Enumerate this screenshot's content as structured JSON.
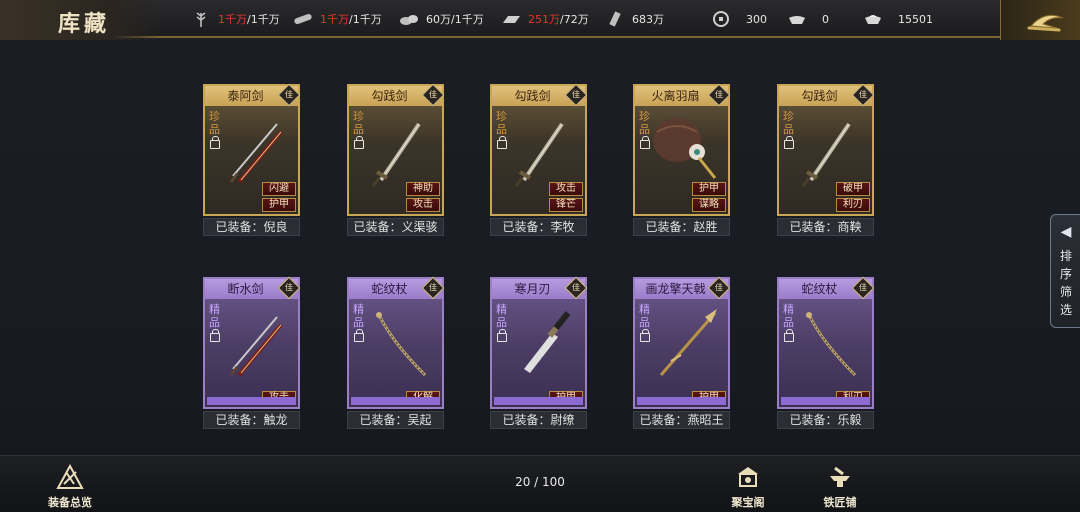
{
  "header": {
    "title": "库藏",
    "resources": [
      {
        "icon": "wheat-icon",
        "value": "1千万",
        "max": "/1千万",
        "value_red": true
      },
      {
        "icon": "wood-icon",
        "value": "1千万",
        "max": "/1千万",
        "value_red": true
      },
      {
        "icon": "stone-icon",
        "value": "60万",
        "max": "/1千万",
        "value_red": false
      },
      {
        "icon": "iron-icon",
        "value": "251万",
        "max": "/72万",
        "value_red": true
      },
      {
        "icon": "decree-icon",
        "value": "683万",
        "max": "",
        "value_red": false
      },
      {
        "icon": "copper-coin-icon",
        "value": "300",
        "max": "",
        "value_red": false
      },
      {
        "icon": "gold-ingot-icon",
        "value": "0",
        "max": "",
        "value_red": false
      },
      {
        "icon": "silver-ingot-icon",
        "value": "15501",
        "max": "",
        "value_red": false
      }
    ]
  },
  "badge_label": "佳",
  "equipped_prefix": "已装备：",
  "cards": [
    {
      "name": "泰阿剑",
      "grade": "珍品",
      "rarity": "gold",
      "weapon": "sword-pair",
      "attrs": [
        "闪避",
        "护甲"
      ],
      "owner": "倪良"
    },
    {
      "name": "勾践剑",
      "grade": "珍品",
      "rarity": "gold",
      "weapon": "sword",
      "attrs": [
        "神助",
        "攻击"
      ],
      "owner": "义渠骇"
    },
    {
      "name": "勾践剑",
      "grade": "珍品",
      "rarity": "gold",
      "weapon": "sword",
      "attrs": [
        "攻击",
        "锋芒"
      ],
      "owner": "李牧"
    },
    {
      "name": "火离羽扇",
      "grade": "珍品",
      "rarity": "gold",
      "weapon": "fan",
      "attrs": [
        "护甲",
        "谋略"
      ],
      "owner": "赵胜"
    },
    {
      "name": "勾践剑",
      "grade": "珍品",
      "rarity": "gold",
      "weapon": "sword",
      "attrs": [
        "破甲",
        "利刃"
      ],
      "owner": "商鞅"
    },
    {
      "name": "断水剑",
      "grade": "精品",
      "rarity": "purple",
      "weapon": "sword-pair",
      "attrs": [
        "攻击"
      ],
      "owner": "触龙"
    },
    {
      "name": "蛇纹杖",
      "grade": "精品",
      "rarity": "purple",
      "weapon": "staff",
      "attrs": [
        "化解"
      ],
      "owner": "吴起"
    },
    {
      "name": "寒月刃",
      "grade": "精品",
      "rarity": "purple",
      "weapon": "blade",
      "attrs": [
        "护甲"
      ],
      "owner": "尉缭"
    },
    {
      "name": "画龙擎天戟",
      "grade": "精品",
      "rarity": "purple",
      "weapon": "halberd",
      "attrs": [
        "护甲"
      ],
      "owner": "燕昭王"
    },
    {
      "name": "蛇纹杖",
      "grade": "精品",
      "rarity": "purple",
      "weapon": "staff",
      "attrs": [
        "利刃"
      ],
      "owner": "乐毅"
    }
  ],
  "side_tab": {
    "label": "排序筛选"
  },
  "footer": {
    "overview_label": "装备总览",
    "page_count": "20 / 100",
    "treasure_label": "聚宝阁",
    "smith_label": "铁匠铺"
  }
}
